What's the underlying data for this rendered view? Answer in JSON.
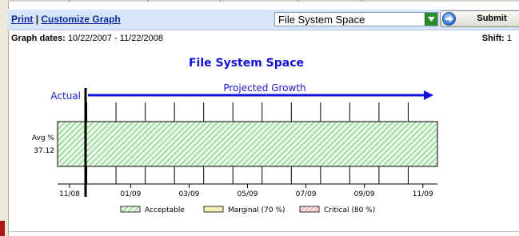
{
  "toolbar": {
    "print_label": "Print",
    "separator": "|",
    "customize_label": "Customize Graph",
    "select_value": "File System Space",
    "submit_label": "Submit"
  },
  "info": {
    "dates_label": "Graph dates:",
    "dates_value": "10/22/2007 - 11/22/2008",
    "shift_label": "Shift:",
    "shift_value": "1"
  },
  "chart_data": {
    "type": "bar",
    "title": "File System Space",
    "actual_label": "Actual",
    "projected_label": "Projected Growth",
    "ylabel": "Avg %",
    "value": 37.12,
    "value_label": "37.12",
    "x_tick_labels": [
      "11/08",
      "01/09",
      "03/09",
      "05/09",
      "07/09",
      "09/09",
      "11/09"
    ],
    "legend": [
      {
        "name": "Acceptable",
        "color": "#6ad06a"
      },
      {
        "name": "Marginal (70 %)",
        "color": "#f0e890"
      },
      {
        "name": "Critical (80 %)",
        "color": "#e89090"
      }
    ]
  }
}
